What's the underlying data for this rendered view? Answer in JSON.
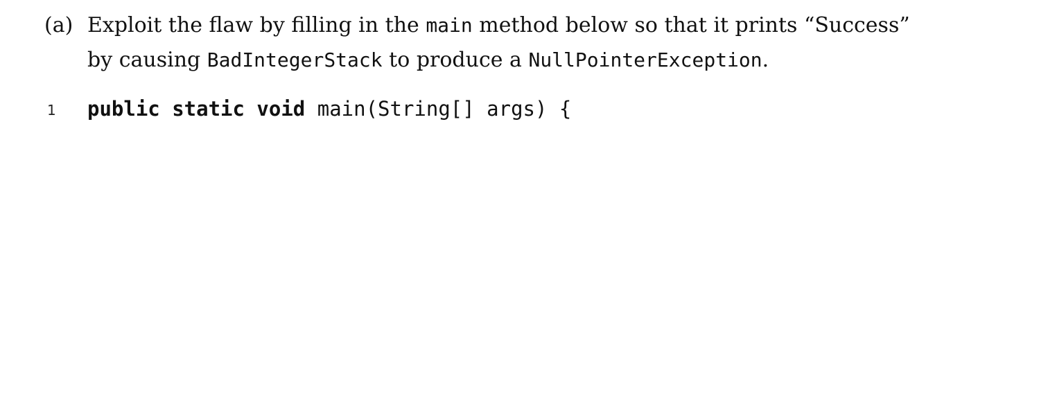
{
  "question": {
    "label": "(a)",
    "line1": {
      "before": "Exploit the flaw by filling in the ",
      "code": "main",
      "after": " method below so that it prints “Success”"
    },
    "line2": {
      "before": "by causing ",
      "code1": "BadIntegerStack",
      "middle": " to produce a ",
      "code2": "NullPointerException",
      "after": "."
    }
  },
  "code_listing": {
    "lines": [
      {
        "number": "1",
        "keywords": "public static void",
        "rest": " main(String[] args) {"
      }
    ]
  }
}
